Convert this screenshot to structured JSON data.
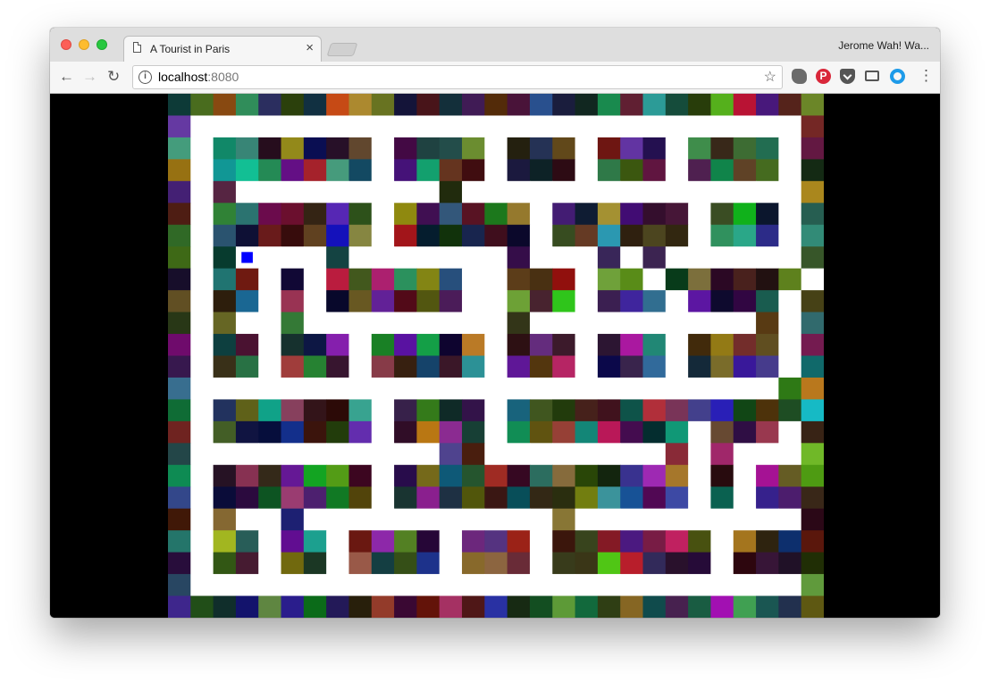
{
  "window": {
    "tab_title": "A Tourist in Paris",
    "tab_close": "×",
    "profile_name": "Jerome Wah! Wa..."
  },
  "toolbar": {
    "url_host": "localhost",
    "url_port": ":8080",
    "back_glyph": "←",
    "forward_glyph": "→",
    "reload_glyph": "↻",
    "info_glyph": "i",
    "star_glyph": "☆",
    "menu_glyph": "⋮",
    "pinterest_glyph": "P"
  },
  "maze": {
    "rows": [
      "#############################",
      "#...........................#",
      "#.#######.####.###.###.####.#",
      "#.#######.####.###.###.####.#",
      "#.#.........#...............#",
      "#.#######.######.######.###.#",
      "#.#######.######.######.###.#",
      "#.#P...#.......#...#.#......#",
      "#.##.#.######..###.##.######.",
      "#.##.#.######..###.###.####.#",
      "#.#..#.........#..........#.#",
      "#.##.###.#####.###.###.####.#",
      "#.##.###.#####.###.###.####.#",
      "#..........................##",
      "#.#######.####.###############",
      "#.#######.####.########.###.#",
      "#...........##........#.#...#",
      "#.#######.#############.#.###",
      "#.#######.#############.#.###",
      "#.#..#...........#..........#",
      "#.##.##.####.###.#######.####",
      "#.##.##.####.###.#######.####",
      "#...........................#",
      "#############################"
    ],
    "player_color": "#0000ff",
    "path_color": "#ffffff"
  }
}
